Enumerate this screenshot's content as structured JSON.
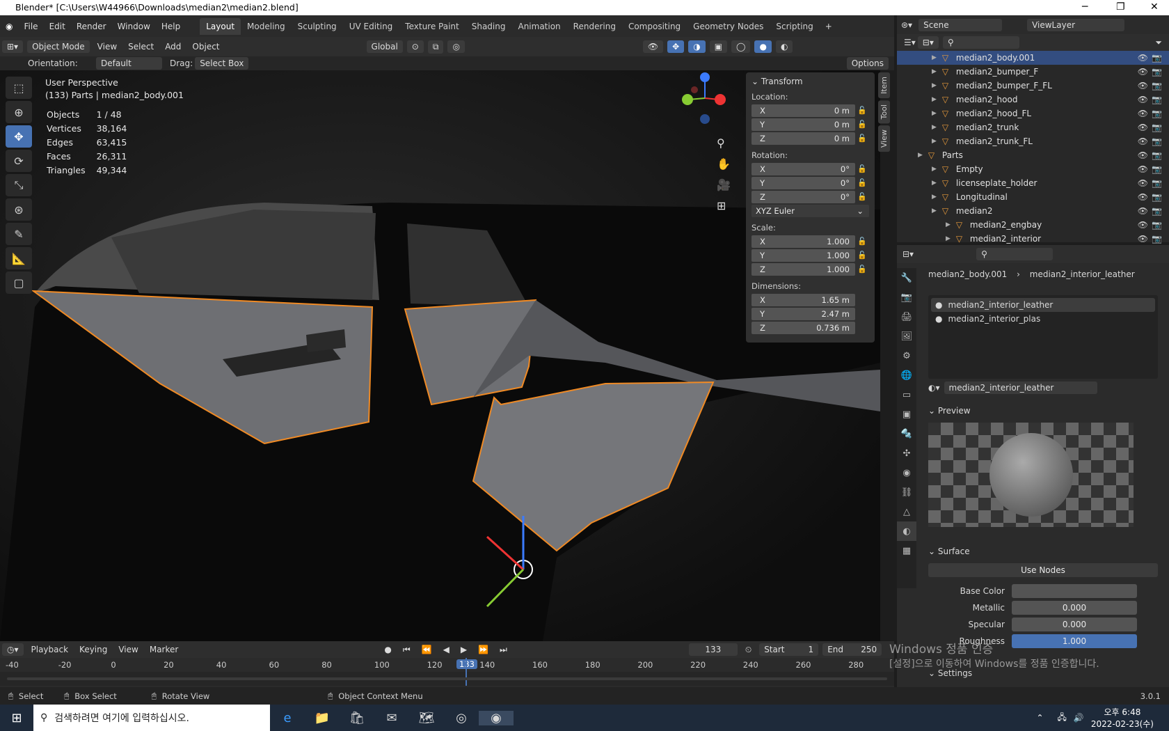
{
  "window": {
    "title": "Blender* [C:\\Users\\W44966\\Downloads\\median2\\median2.blend]"
  },
  "menu": [
    "File",
    "Edit",
    "Render",
    "Window",
    "Help"
  ],
  "workspaces": [
    "Layout",
    "Modeling",
    "Sculpting",
    "UV Editing",
    "Texture Paint",
    "Shading",
    "Animation",
    "Rendering",
    "Compositing",
    "Geometry Nodes",
    "Scripting"
  ],
  "header": {
    "mode": "Object Mode",
    "view": "View",
    "select": "Select",
    "add": "Add",
    "object": "Object",
    "transform": "Global"
  },
  "toolsettings": {
    "orientation_label": "Orientation:",
    "orientation": "Default",
    "drag_label": "Drag:",
    "drag": "Select Box",
    "options": "Options"
  },
  "viewport": {
    "perspective": "User Perspective",
    "context": "(133) Parts | median2_body.001",
    "stats": [
      {
        "k": "Objects",
        "v": "1 / 48"
      },
      {
        "k": "Vertices",
        "v": "38,164"
      },
      {
        "k": "Edges",
        "v": "63,415"
      },
      {
        "k": "Faces",
        "v": "26,311"
      },
      {
        "k": "Triangles",
        "v": "49,344"
      }
    ]
  },
  "npanel": {
    "title": "Transform",
    "location": "Location:",
    "rotation": "Rotation:",
    "scale": "Scale:",
    "dimensions": "Dimensions:",
    "rotation_mode": "XYZ Euler",
    "loc": [
      {
        "a": "X",
        "v": "0 m"
      },
      {
        "a": "Y",
        "v": "0 m"
      },
      {
        "a": "Z",
        "v": "0 m"
      }
    ],
    "rot": [
      {
        "a": "X",
        "v": "0°"
      },
      {
        "a": "Y",
        "v": "0°"
      },
      {
        "a": "Z",
        "v": "0°"
      }
    ],
    "scl": [
      {
        "a": "X",
        "v": "1.000"
      },
      {
        "a": "Y",
        "v": "1.000"
      },
      {
        "a": "Z",
        "v": "1.000"
      }
    ],
    "dim": [
      {
        "a": "X",
        "v": "1.65 m"
      },
      {
        "a": "Y",
        "v": "2.47 m"
      },
      {
        "a": "Z",
        "v": "0.736 m"
      }
    ],
    "tabs": [
      "Item",
      "Tool",
      "View"
    ]
  },
  "timeline": {
    "playback": "Playback",
    "keying": "Keying",
    "view": "View",
    "marker": "Marker",
    "frame": "133",
    "start_label": "Start",
    "start": "1",
    "end_label": "End",
    "end": "250",
    "ticks": [
      "-40",
      "-20",
      "0",
      "20",
      "40",
      "60",
      "80",
      "100",
      "120",
      "140",
      "160",
      "180",
      "200",
      "220",
      "240",
      "260",
      "280"
    ],
    "current": "133"
  },
  "status": {
    "select": "Select",
    "box": "Box Select",
    "rotate": "Rotate View",
    "context": "Object Context Menu",
    "version": "3.0.1"
  },
  "scene": {
    "scene": "Scene",
    "viewlayer": "ViewLayer"
  },
  "outliner": [
    {
      "name": "median2_body.001",
      "indent": 1,
      "sel": true
    },
    {
      "name": "median2_bumper_F",
      "indent": 1
    },
    {
      "name": "median2_bumper_F_FL",
      "indent": 1
    },
    {
      "name": "median2_hood",
      "indent": 1
    },
    {
      "name": "median2_hood_FL",
      "indent": 1
    },
    {
      "name": "median2_trunk",
      "indent": 1
    },
    {
      "name": "median2_trunk_FL",
      "indent": 1
    },
    {
      "name": "Parts",
      "indent": 0
    },
    {
      "name": "Empty",
      "indent": 1
    },
    {
      "name": "licenseplate_holder",
      "indent": 1
    },
    {
      "name": "Longitudinal",
      "indent": 1
    },
    {
      "name": "median2",
      "indent": 1
    },
    {
      "name": "median2_engbay",
      "indent": 2
    },
    {
      "name": "median2_interior",
      "indent": 2
    }
  ],
  "props": {
    "object": "median2_body.001",
    "material": "median2_interior_leather",
    "slots": [
      "median2_interior_leather",
      "median2_interior_plas"
    ],
    "matfield": "median2_interior_leather",
    "preview": "Preview",
    "surface": "Surface",
    "use_nodes": "Use Nodes",
    "fields": [
      {
        "k": "Base Color",
        "v": ""
      },
      {
        "k": "Metallic",
        "v": "0.000"
      },
      {
        "k": "Specular",
        "v": "0.000"
      },
      {
        "k": "Roughness",
        "v": "1.000"
      }
    ],
    "settings": "Settings"
  },
  "watermark": {
    "line1": "Windows 정품 인증",
    "line2": "[설정]으로 이동하여 Windows를 정품 인증합니다."
  },
  "taskbar": {
    "search": "검색하려면 여기에 입력하십시오.",
    "time": "오후 6:48",
    "date": "2022-02-23(수)"
  }
}
